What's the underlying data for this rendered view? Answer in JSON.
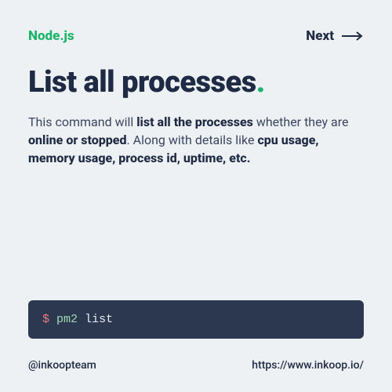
{
  "topbar": {
    "brand": "Node.js",
    "next_label": "Next"
  },
  "title": {
    "text": "List all processes",
    "dot": "."
  },
  "description": {
    "p1": "This command will ",
    "b1": "list all the processes",
    "p2": " whether they are ",
    "b2": "online or stopped",
    "p3": ". Along with details like ",
    "b3": "cpu usage, memory usage, process id, uptime, etc."
  },
  "code": {
    "prompt": "$",
    "command": "pm2",
    "arg": "list"
  },
  "footer": {
    "handle": "@inkoopteam",
    "url": "https://www.inkoop.io/"
  }
}
